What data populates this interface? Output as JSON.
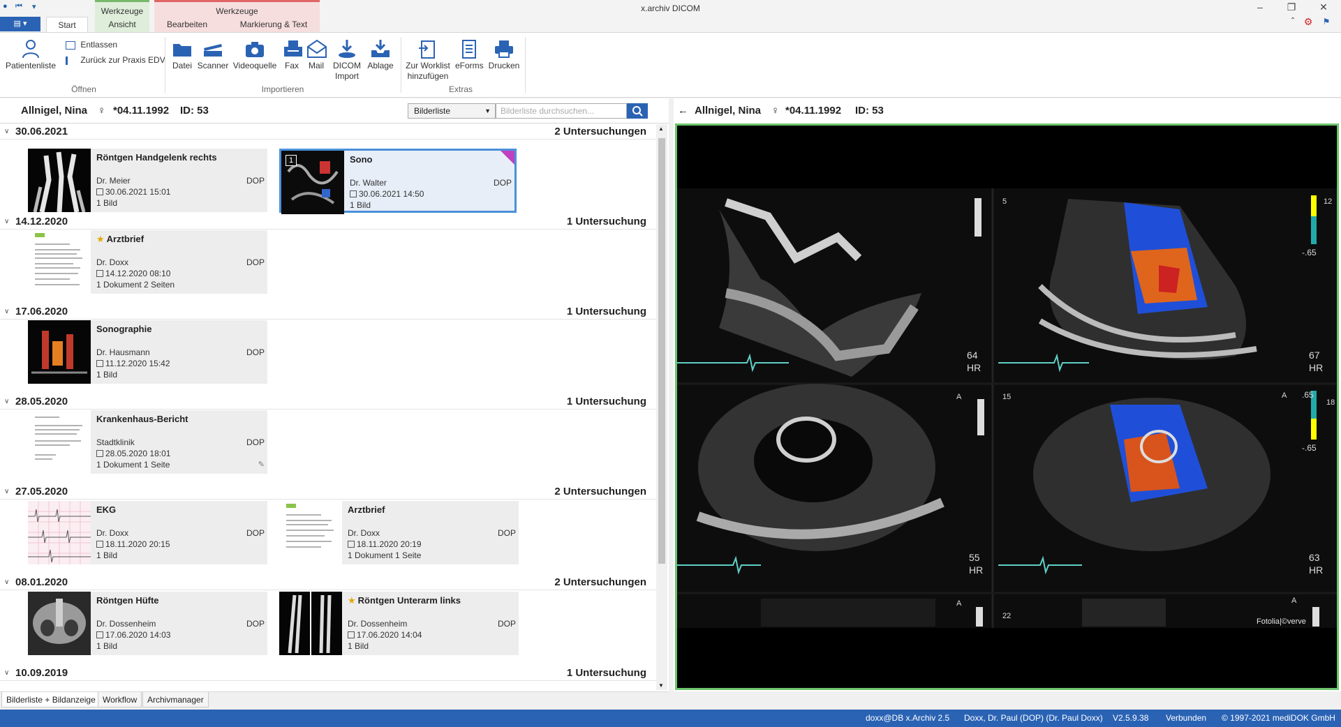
{
  "window": {
    "title": "x.archiv DICOM",
    "controls": [
      "–",
      "❐",
      "✕"
    ]
  },
  "ribbon_tabs": {
    "file_label": "▤ ▾",
    "start": "Start",
    "context_green_label": "Werkzeuge",
    "ansicht": "Ansicht",
    "context_red_label": "Werkzeuge",
    "bearbeiten": "Bearbeiten",
    "markierung": "Markierung & Text"
  },
  "ribbon": {
    "patientenliste": "Patientenliste",
    "entlassen": "Entlassen",
    "zurueck": "Zurück zur Praxis EDV",
    "group_oeffnen": "Öffnen",
    "datei": "Datei",
    "scanner": "Scanner",
    "videoquelle": "Videoquelle",
    "fax": "Fax",
    "mail": "Mail",
    "dicom_import_1": "DICOM",
    "dicom_import_2": "Import",
    "ablage": "Ablage",
    "group_importieren": "Importieren",
    "worklist_1": "Zur Worklist",
    "worklist_2": "hinzufügen",
    "eforms": "eForms",
    "drucken": "Drucken",
    "group_extras": "Extras"
  },
  "patient": {
    "name": "Allnigel, Nina",
    "gender_symbol": "♀",
    "birth": "*04.11.1992",
    "id": "ID: 53"
  },
  "list_toolbar": {
    "view_value": "Bilderliste",
    "search_placeholder": "Bilderliste durchsuchen..."
  },
  "groups": [
    {
      "date": "30.06.2021",
      "count": "2 Untersuchungen",
      "items": [
        {
          "title": "Röntgen Handgelenk rechts",
          "doctor": "Dr. Meier",
          "site": "DOP",
          "datetime": "30.06.2021 15:01",
          "count": "1 Bild"
        },
        {
          "title": "Sono",
          "doctor": "Dr. Walter",
          "site": "DOP",
          "datetime": "30.06.2021 14:50",
          "count": "1 Bild",
          "badge": "1"
        }
      ]
    },
    {
      "date": "14.12.2020",
      "count": "1 Untersuchung",
      "items": [
        {
          "title": "Arztbrief",
          "doctor": "Dr. Doxx",
          "site": "DOP",
          "datetime": "14.12.2020 08:10",
          "count": "1 Dokument 2 Seiten"
        }
      ]
    },
    {
      "date": "17.06.2020",
      "count": "1 Untersuchung",
      "items": [
        {
          "title": "Sonographie",
          "doctor": "Dr. Hausmann",
          "site": "DOP",
          "datetime": "11.12.2020 15:42",
          "count": "1 Bild"
        }
      ]
    },
    {
      "date": "28.05.2020",
      "count": "1 Untersuchung",
      "items": [
        {
          "title": "Krankenhaus-Bericht",
          "doctor": "Stadtklinik",
          "site": "DOP",
          "datetime": "28.05.2020 18:01",
          "count": "1 Dokument 1 Seite"
        }
      ]
    },
    {
      "date": "27.05.2020",
      "count": "2 Untersuchungen",
      "items": [
        {
          "title": "EKG",
          "doctor": "Dr. Doxx",
          "site": "DOP",
          "datetime": "18.11.2020 20:15",
          "count": "1 Bild"
        },
        {
          "title": "Arztbrief",
          "doctor": "Dr. Doxx",
          "site": "DOP",
          "datetime": "18.11.2020 20:19",
          "count": "1 Dokument 1 Seite"
        }
      ]
    },
    {
      "date": "08.01.2020",
      "count": "2 Untersuchungen",
      "items": [
        {
          "title": "Röntgen Hüfte",
          "doctor": "Dr. Dossenheim",
          "site": "DOP",
          "datetime": "17.06.2020 14:03",
          "count": "1 Bild"
        },
        {
          "title": "Röntgen Unterarm links",
          "doctor": "Dr. Dossenheim",
          "site": "DOP",
          "datetime": "17.06.2020 14:04",
          "count": "1 Bild"
        }
      ]
    },
    {
      "date": "10.09.2019",
      "count": "1 Untersuchung",
      "items": []
    }
  ],
  "viewer": {
    "back_arrow": "←",
    "overlay": {
      "q1_num": "5",
      "q1_hr": "64",
      "q1_hr_lbl": "HR",
      "q2_num": "12",
      "q2_scale": "-.65",
      "q2_hr": "67",
      "q2_hr_lbl": "HR",
      "q3_a": "A",
      "q3_hr": "55",
      "q3_hr_lbl": "HR",
      "q4_num": "15",
      "q4_a": "A",
      "q4_scale_top": ".65",
      "q4_num2": "18",
      "q4_scale_bot": "-.65",
      "q4_hr": "63",
      "q4_hr_lbl": "HR",
      "q5_a": "A",
      "q5_num": "22",
      "q6_a": "A",
      "credit": "Fotolia|©verve"
    }
  },
  "bottom_tabs": [
    "Bilderliste + Bildanzeige",
    "Workflow",
    "Archivmanager"
  ],
  "status": {
    "db": "doxx@DB x.Archiv 2.5",
    "user": "Doxx, Dr. Paul (DOP) (Dr. Paul Doxx)",
    "version": "V2.5.9.38",
    "state": "Verbunden",
    "copyright": "© 1997-2021 mediDOK GmbH"
  },
  "colors": {
    "accent": "#2b63b4",
    "selected_border": "#4a90d9",
    "viewer_frame": "#6dc46d",
    "context_green": "#78b86b",
    "context_red": "#e06565",
    "checkmark": "#c040c0"
  }
}
